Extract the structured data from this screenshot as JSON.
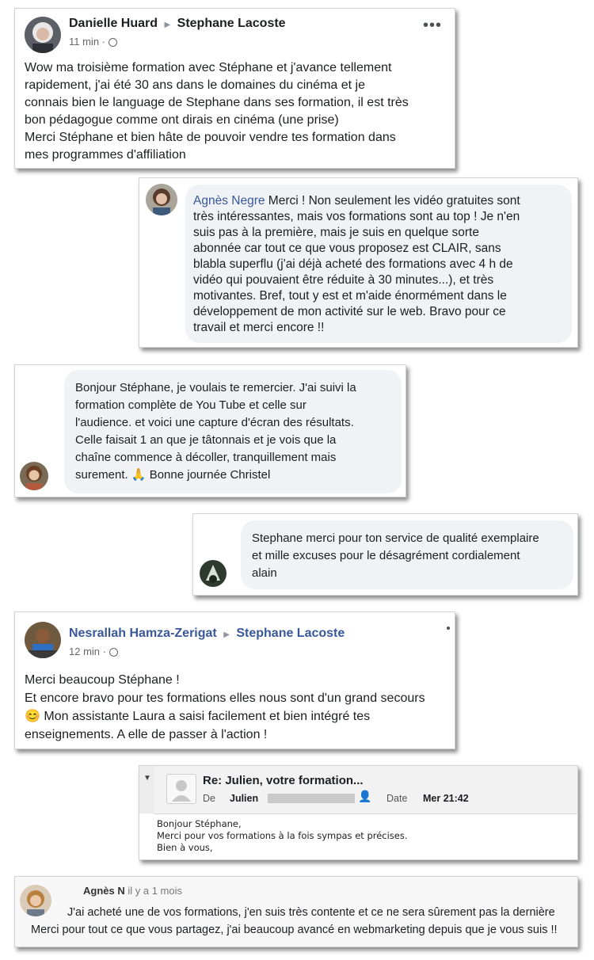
{
  "colors": {
    "link_blue": "#385898",
    "bubble_gray": "#f0f2f5",
    "card_border": "#d0d2d6"
  },
  "post1": {
    "author": "Danielle Huard",
    "target": "Stephane Lacoste",
    "time": "11 min",
    "privacy_icon": "globe-icon",
    "more_icon": "•••",
    "lines": [
      "Wow ma troisième formation avec Stéphane et j'avance tellement",
      "rapidement, j'ai été 30 ans dans le domaines du cinéma et je",
      "connais bien le language de Stephane dans ses formation, il est très",
      "bon pédagogue comme ont dirais en cinéma (une prise)",
      "Merci Stéphane et bien hâte de pouvoir vendre tes formation dans",
      "mes programmes d'affiliation"
    ]
  },
  "comment1": {
    "author": "Agnès Negre",
    "lines": [
      " Merci ! Non seulement les vidéo gratuites sont",
      "très intéressantes, mais vos formations sont au top ! Je n'en",
      "suis pas à la première, mais je suis en quelque sorte",
      "abonnée car tout ce que vous proposez est CLAIR, sans",
      "blabla superflu (j'ai déjà acheté des formations avec 4 h de",
      "vidéo qui pouvaient être réduite à 30 minutes...), et très",
      "motivantes. Bref, tout y est et m'aide énormément dans le",
      "développement de mon activité sur le web. Bravo pour ce",
      "travail et merci encore !!"
    ]
  },
  "comment2": {
    "lines": [
      "Bonjour Stéphane, je voulais te remercier. J'ai suivi la",
      "formation complète de You Tube et celle sur",
      "l'audience. et voici une capture d'écran des résultats.",
      "Celle faisait 1 an que je tâtonnais et je vois que la",
      "chaîne commence à décoller, tranquillement mais",
      "surement. 🙏  Bonne journée Christel"
    ]
  },
  "comment3": {
    "lines": [
      "Stephane merci pour ton service de qualité exemplaire",
      "et mille excuses pour le désagrément cordialement",
      "alain"
    ]
  },
  "post2": {
    "author": "Nesrallah Hamza-Zerigat",
    "target": "Stephane Lacoste",
    "time": "12 min",
    "privacy_icon": "globe-icon",
    "lines": [
      "Merci beaucoup Stéphane !",
      "Et encore bravo pour tes formations elles nous sont d'un grand secours",
      "😊 Mon assistante Laura a saisi facilement et bien intégré tes",
      "enseignements. A elle de passer à l'action !"
    ]
  },
  "email": {
    "subject": "Re: Julien, votre formation...",
    "from_label": "De",
    "from_name": "Julien",
    "date_label": "Date",
    "date_value": "Mer 21:42",
    "lines": [
      "Bonjour Stéphane,",
      "Merci pour vos formations à la fois sympas et précises.",
      "Bien à vous,"
    ]
  },
  "review": {
    "author": "Agnès N",
    "time": "il y a 1 mois",
    "line1": "J'ai acheté une de vos formations, j'en suis très contente et ce ne sera sûrement pas la dernière",
    "line2": "Merci pour tout ce que vous partagez, j'ai beaucoup avancé en webmarketing depuis que je vous suis !!"
  }
}
